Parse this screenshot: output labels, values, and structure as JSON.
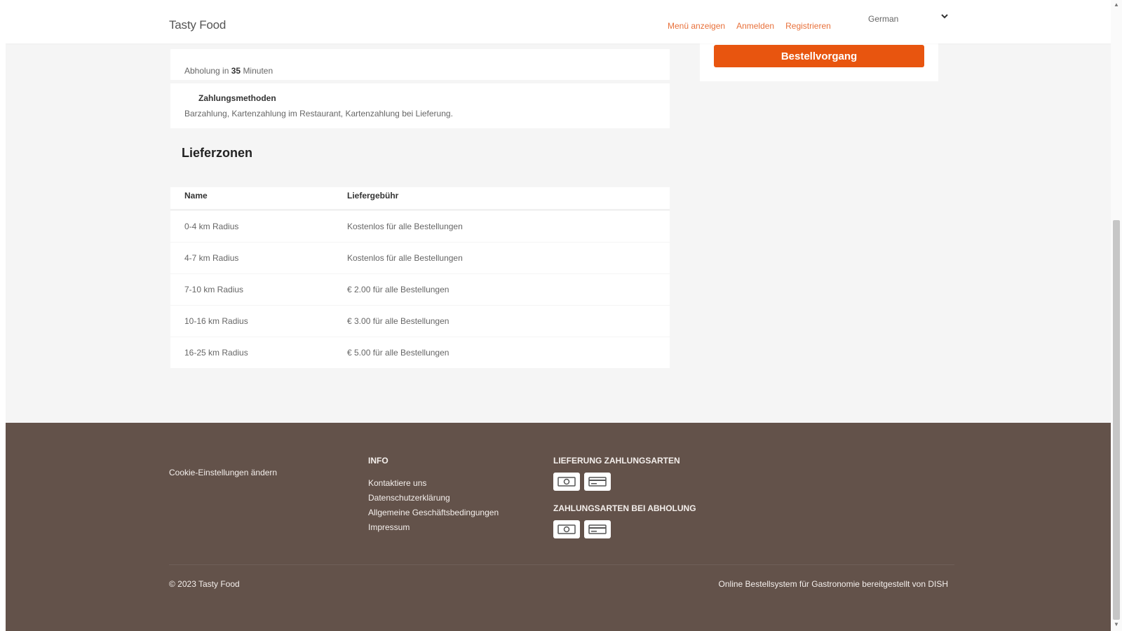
{
  "header": {
    "brand": "Tasty Food",
    "nav": [
      "Menü anzeigen",
      "Anmelden",
      "Registrieren"
    ],
    "language": "German"
  },
  "main": {
    "pickup_prefix": "Abholung in",
    "pickup_minutes": "35",
    "pickup_suffix": "Minuten",
    "payments_title": "Zahlungsmethoden",
    "payments_text": "Barzahlung, Kartenzahlung im Restaurant, Kartenzahlung bei Lieferung.",
    "zones_title": "Lieferzonen",
    "table": {
      "headers": [
        "Name",
        "Liefergebühr"
      ],
      "rows": [
        [
          "0-4 km Radius",
          "Kostenlos für alle Bestellungen"
        ],
        [
          "4-7 km Radius",
          "Kostenlos für alle Bestellungen"
        ],
        [
          "7-10 km Radius",
          "€ 2.00 für alle Bestellungen"
        ],
        [
          "10-16 km Radius",
          "€ 3.00 für alle Bestellungen"
        ],
        [
          "16-25 km Radius",
          "€ 5.00 für alle Bestellungen"
        ]
      ]
    }
  },
  "sidebar": {
    "order_button": "Bestellvorgang"
  },
  "footer": {
    "cookie": "Cookie-Einstellungen ändern",
    "info_title": "INFO",
    "info_links": [
      "Kontaktiere uns",
      "Datenschutzerklärung",
      "Allgemeine Geschäftsbedingungen",
      "Impressum"
    ],
    "delivery_payments_title": "LIEFERUNG ZAHLUNGSARTEN",
    "pickup_payments_title": "ZAHLUNGSARTEN BEI ABHOLUNG",
    "copyright": "© 2023 Tasty Food",
    "powered_by": "Online Bestellsystem für Gastronomie bereitgestellt von DISH"
  },
  "icons": {
    "cash": "cash-icon",
    "card": "card-icon"
  },
  "colors": {
    "accent": "#e8550f",
    "nav_link": "#e8703a",
    "footer_bg": "#63524a"
  }
}
